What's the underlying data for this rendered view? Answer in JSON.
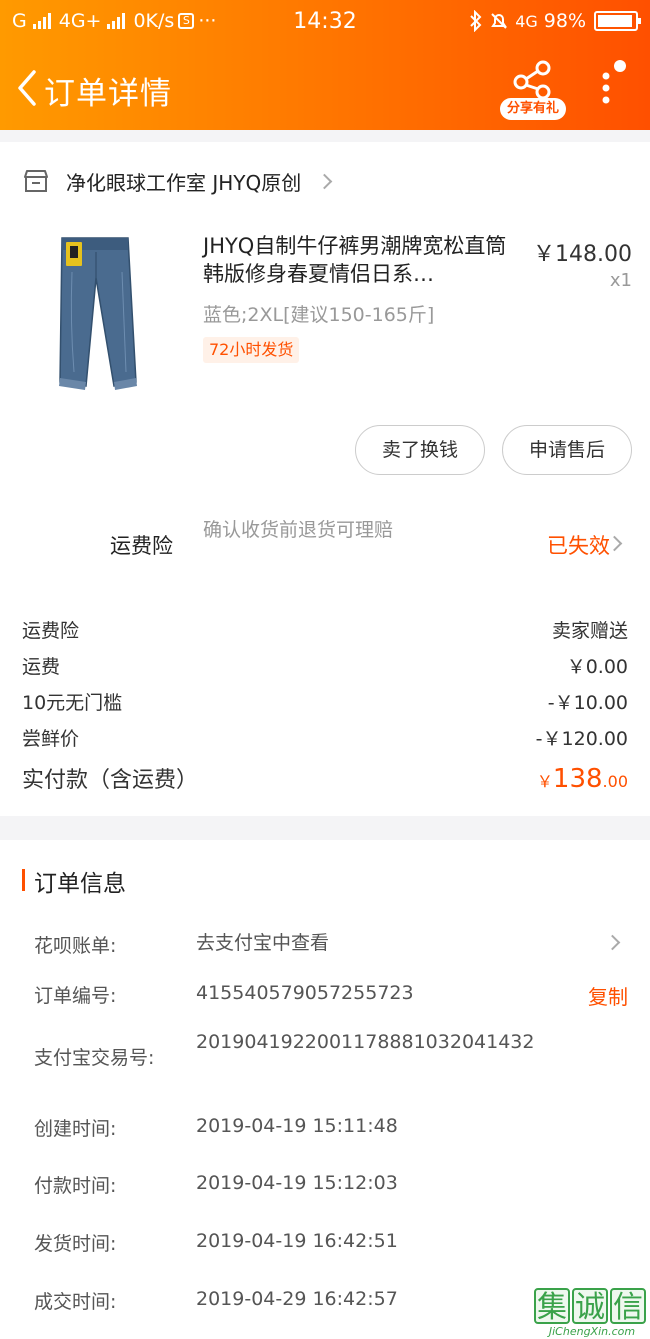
{
  "status_bar": {
    "carrier": "G",
    "network": "4G+",
    "speed": "0K/s",
    "s_icon": "S",
    "dots": "···",
    "time": "14:32",
    "network_right": "4G",
    "battery": "98%"
  },
  "nav": {
    "title": "订单详情",
    "share_label": "分享有礼",
    "colors": {
      "gradient_start": "#ff9a00",
      "gradient_end": "#ff5000"
    }
  },
  "shop": {
    "name": "净化眼球工作室 JHYQ原创"
  },
  "product": {
    "title": "JHYQ自制牛仔裤男潮牌宽松直筒韩版修身春夏情侣日系…",
    "price": "￥148.00",
    "qty": "x1",
    "sku": "蓝色;2XL[建议150-165斤]",
    "tag": "72小时发货"
  },
  "actions": {
    "sell": "卖了换钱",
    "after_sale": "申请售后"
  },
  "insurance": {
    "label": "运费险",
    "desc": "确认收货前退货可理赔",
    "status": "已失效"
  },
  "fees": [
    {
      "label": "运费险",
      "value": "卖家赠送"
    },
    {
      "label": "运费",
      "value": "￥0.00"
    },
    {
      "label": "10元无门槛",
      "value": "-￥10.00"
    },
    {
      "label": "尝鲜价",
      "value": "-￥120.00"
    }
  ],
  "total": {
    "label": "实付款（含运费）",
    "currency": "￥",
    "int": "138",
    "dec": ".00"
  },
  "order_info": {
    "title": "订单信息",
    "copy_label": "复制",
    "rows": [
      {
        "label": "花呗账单:",
        "value": "去支付宝中查看"
      },
      {
        "label": "订单编号:",
        "value": "415540579057255723"
      },
      {
        "label": "支付宝交易号:",
        "value": "2019041922001178881032041432"
      },
      {
        "label": "创建时间:",
        "value": "2019-04-19 15:11:48"
      },
      {
        "label": "付款时间:",
        "value": "2019-04-19 15:12:03"
      },
      {
        "label": "发货时间:",
        "value": "2019-04-19 16:42:51"
      },
      {
        "label": "成交时间:",
        "value": "2019-04-29 16:42:57"
      }
    ]
  },
  "watermark": {
    "chars": [
      "集",
      "诚",
      "信"
    ],
    "sub": "JiChengXin.com"
  }
}
